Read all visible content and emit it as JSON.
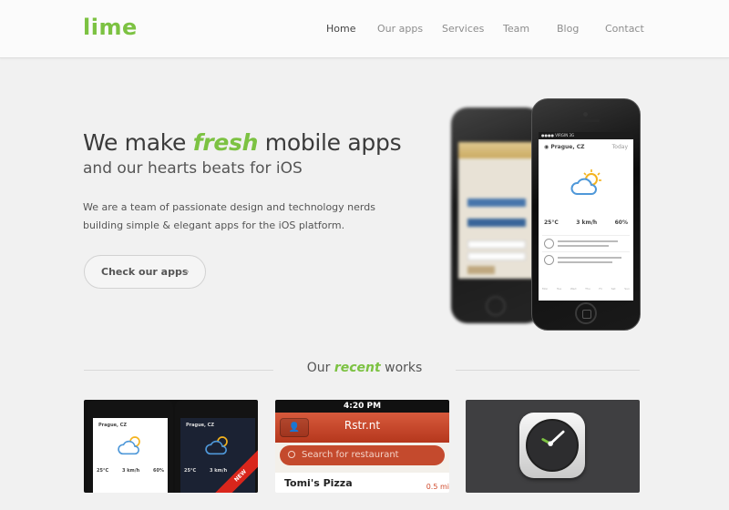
{
  "header": {
    "logo": "lime",
    "nav": [
      "Home",
      "Our apps",
      "Services",
      "Team",
      "Blog",
      "Contact"
    ],
    "active_nav": "Home"
  },
  "hero": {
    "title_pre": "We make ",
    "title_em": "fresh",
    "title_post": " mobile apps",
    "subtitle": "and our hearts beats for iOS",
    "text": "We are a team of passionate design and technology nerds building simple & elegant apps for the iOS platform.",
    "cta": "Check our apps"
  },
  "phone": {
    "location": "Prague, CZ",
    "day": "Today",
    "temp": "25°C",
    "wind": "3 km/h",
    "humidity": "60%",
    "days": [
      "Mon",
      "Tue",
      "Wed",
      "Thu",
      "Fri",
      "Sat",
      "Sun"
    ]
  },
  "section": {
    "title_pre": "Our ",
    "title_em": "recent",
    "title_post": " works"
  },
  "works": {
    "weather": {
      "location": "Prague, CZ",
      "temp": "25°C",
      "wind": "3 km/h",
      "humidity": "60%",
      "badge": "NEW"
    },
    "restaurant": {
      "time": "4:20 PM",
      "app_title": "Rstr.nt",
      "search_placeholder": "Search for restaurant",
      "first_item": "Tomi's Pizza",
      "distance": "0.5 mi"
    }
  },
  "colors": {
    "brand_green": "#7cc242",
    "restaurant_red": "#c8452a",
    "ribbon_red": "#d9261c"
  }
}
